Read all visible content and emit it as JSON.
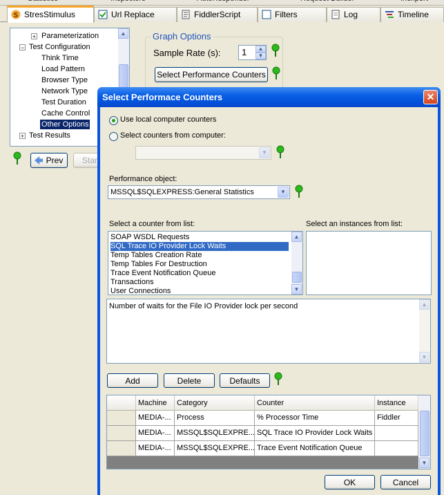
{
  "top_tabs": [
    "Statistics",
    "Inspectors",
    "AutoResponder",
    "Request Builder",
    "Inexpert"
  ],
  "tabs": [
    {
      "label": "StresStimulus"
    },
    {
      "label": "Url Replace"
    },
    {
      "label": "FiddlerScript"
    },
    {
      "label": "Filters"
    },
    {
      "label": "Log"
    },
    {
      "label": "Timeline"
    }
  ],
  "tree": {
    "parameterization": "Parameterization",
    "test_configuration": "Test Configuration",
    "children": [
      "Think Time",
      "Load Pattern",
      "Browser Type",
      "Network Type",
      "Test Duration",
      "Cache Control",
      "Other Options"
    ],
    "test_results": "Test Results"
  },
  "nav": {
    "prev": "Prev",
    "start": "Start"
  },
  "graph_options": {
    "legend": "Graph Options",
    "sample_rate_label": "Sample Rate (s):",
    "sample_rate_value": "1",
    "select_counters_button": "Select Performance Counters"
  },
  "dialog": {
    "title": "Select Performace Counters",
    "close": "✕",
    "radio_local": "Use local computer counters",
    "radio_remote": "Select counters from computer:",
    "computer_value": "",
    "perf_object_label": "Performance object:",
    "perf_object_value": "MSSQL$SQLEXPRESS:General Statistics",
    "counter_list_label": "Select a counter from list:",
    "instances_label": "Select an instances from list:",
    "counters": [
      "SOAP WSDL Requests",
      "SQL Trace IO Provider Lock Waits",
      "Temp Tables Creation Rate",
      "Temp Tables For Destruction",
      "Trace Event Notification Queue",
      "Transactions",
      "User Connections"
    ],
    "selected_counter_index": 1,
    "description": "Number of waits for the File IO Provider lock per second",
    "buttons": {
      "add": "Add",
      "delete": "Delete",
      "defaults": "Defaults",
      "ok": "OK",
      "cancel": "Cancel"
    },
    "grid": {
      "columns": [
        "Machine",
        "Category",
        "Counter",
        "Instance"
      ],
      "rows": [
        [
          "MEDIA-...",
          "Process",
          "% Processor Time",
          "Fiddler"
        ],
        [
          "MEDIA-...",
          "MSSQL$SQLEXPRE...",
          "SQL Trace IO Provider Lock Waits",
          ""
        ],
        [
          "MEDIA-...",
          "MSSQL$SQLEXPRE...",
          "Trace Event Notification Queue",
          ""
        ]
      ]
    }
  },
  "colors": {
    "accent_tab": "#f7a528",
    "title_bar": "#0a5fe6",
    "selection": "#316ac5",
    "pin": "#2db81e"
  }
}
